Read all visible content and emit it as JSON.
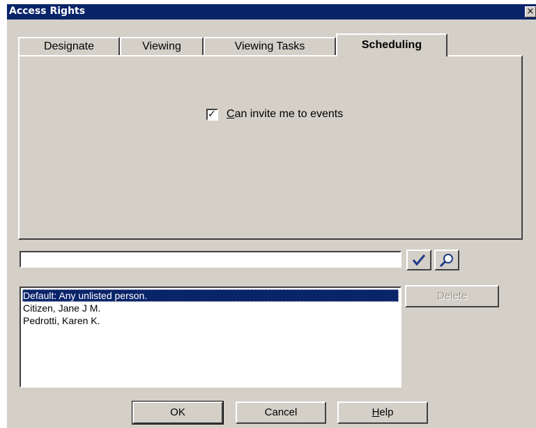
{
  "window": {
    "title": "Access Rights",
    "close_glyph": "×"
  },
  "tabs": [
    {
      "label": "Designate",
      "active": false
    },
    {
      "label": "Viewing",
      "active": false
    },
    {
      "label": "Viewing Tasks",
      "active": false
    },
    {
      "label": "Scheduling",
      "active": true
    }
  ],
  "scheduling": {
    "checkbox_label_mnemonic": "C",
    "checkbox_label_rest": "an invite me to events",
    "checkbox_checked": true,
    "check_glyph": "✓"
  },
  "name_input": {
    "value": ""
  },
  "icons": {
    "check_button": "checkmark-icon",
    "find_button": "magnifier-icon"
  },
  "people_list": [
    {
      "label": "Default: Any unlisted person.",
      "selected": true
    },
    {
      "label": "Citizen, Jane J M.",
      "selected": false
    },
    {
      "label": "Pedrotti, Karen K.",
      "selected": false
    }
  ],
  "buttons": {
    "delete": "Delete",
    "ok": "OK",
    "cancel": "Cancel",
    "help_mnemonic": "H",
    "help_rest": "elp"
  },
  "colors": {
    "title_bar": "#0a246a",
    "dialog_face": "#d4d0c8",
    "selection": "#0a246a",
    "checkmark_blue": "#1f3a8a"
  }
}
